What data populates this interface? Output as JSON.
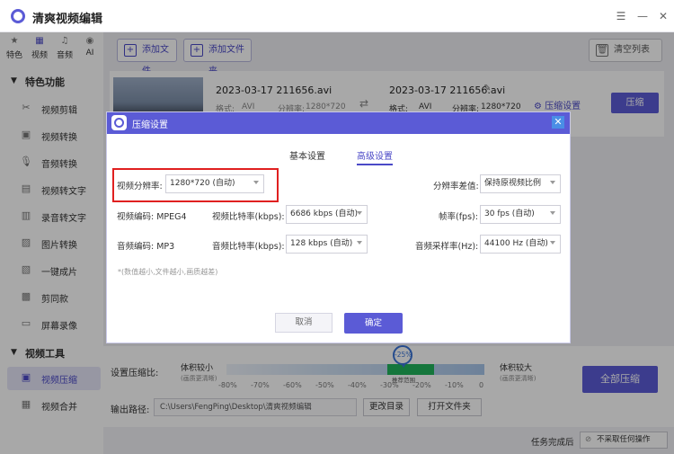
{
  "app": {
    "title": "清爽视频编辑"
  },
  "sidebar": {
    "top_tabs": [
      {
        "label": "特色",
        "icon": "star-icon"
      },
      {
        "label": "视频",
        "icon": "film-icon"
      },
      {
        "label": "音频",
        "icon": "music-icon"
      },
      {
        "label": "AI",
        "icon": "ai-icon"
      }
    ],
    "section1": "特色功能",
    "section2": "视频工具",
    "items": [
      {
        "label": "视频剪辑"
      },
      {
        "label": "视频转换"
      },
      {
        "label": "音频转换"
      },
      {
        "label": "视频转文字"
      },
      {
        "label": "录音转文字"
      },
      {
        "label": "图片转换"
      },
      {
        "label": "一键成片"
      },
      {
        "label": "剪同款"
      },
      {
        "label": "屏幕录像"
      },
      {
        "label": "视频压缩"
      },
      {
        "label": "视频合并"
      }
    ]
  },
  "toolbar": {
    "add_file": "添加文件",
    "add_folder": "添加文件夹",
    "clear_list": "清空列表"
  },
  "file": {
    "source_name": "2023-03-17 211656.avi",
    "target_name": "2023-03-17 211656.avi",
    "format_label": "格式:",
    "format_value": "AVI",
    "resolution_label": "分辨率:",
    "resolution_value": "1280*720",
    "compress_settings": "压缩设置",
    "compress_button": "压缩"
  },
  "dialog": {
    "title": "压缩设置",
    "tab_basic": "基本设置",
    "tab_advanced": "高级设置",
    "video_resolution_label": "视频分辨率:",
    "video_resolution_value": "1280*720 (自动)",
    "resolution_diff_label": "分辨率差值:",
    "resolution_diff_value": "保持原视频比例",
    "video_codec": "视频编码: MPEG4",
    "video_bitrate_label": "视频比特率(kbps):",
    "video_bitrate_value": "6686 kbps (自动)",
    "fps_label": "帧率(fps):",
    "fps_value": "30 fps (自动)",
    "audio_codec": "音频编码: MP3",
    "audio_bitrate_label": "音频比特率(kbps):",
    "audio_bitrate_value": "128 kbps (自动)",
    "audio_rate_label": "音频采样率(Hz):",
    "audio_rate_value": "44100 Hz (自动)",
    "note": "*(数值越小,文件越小,画质越差)",
    "cancel": "取消",
    "ok": "确定"
  },
  "compress": {
    "ratio_label": "设置压缩比:",
    "small_label": "体积较小",
    "small_sub": "(画质更清晰)",
    "large_label": "体积较大",
    "large_sub": "(画质更清晰)",
    "bubble": "-25%",
    "recommend": "推荐范围",
    "ticks": [
      "-80%",
      "-70%",
      "-60%",
      "-50%",
      "-40%",
      "-30%",
      "-20%",
      "-10%",
      "0"
    ],
    "all_button": "全部压缩"
  },
  "output": {
    "label": "输出路径:",
    "path": "C:\\Users\\FengPing\\Desktop\\清爽视频编辑",
    "change_dir": "更改目录",
    "open_folder": "打开文件夹"
  },
  "status": {
    "after_label": "任务完成后",
    "after_value": "不采取任何操作"
  }
}
